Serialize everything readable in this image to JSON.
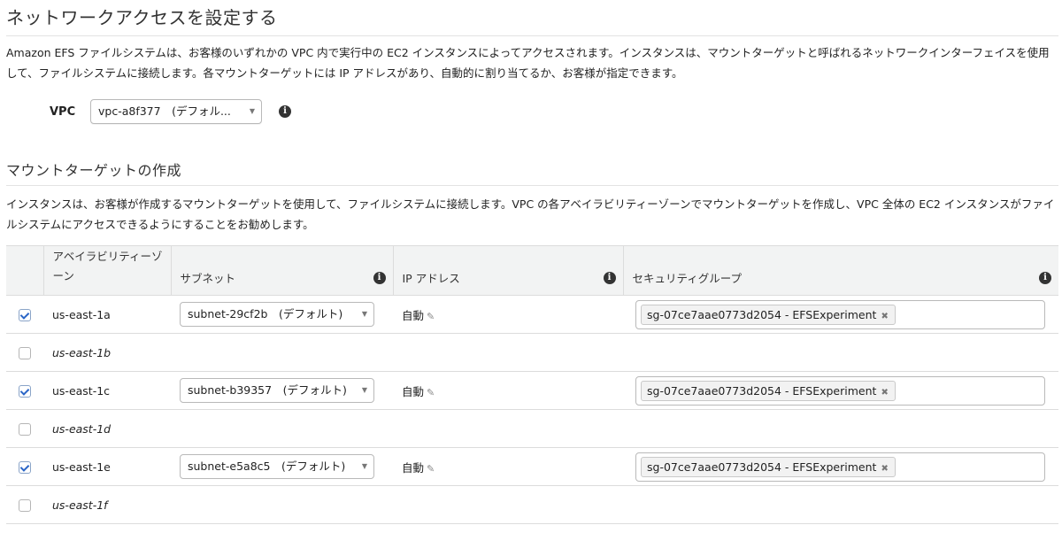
{
  "page": {
    "title": "ネットワークアクセスを設定する",
    "description": "Amazon EFS ファイルシステムは、お客様のいずれかの VPC 内で実行中の EC2 インスタンスによってアクセスされます。インスタンスは、マウントターゲットと呼ばれるネットワークインターフェイスを使用して、ファイルシステムに接続します。各マウントターゲットには IP アドレスがあり、自動的に割り当てるか、お客様が指定できます。"
  },
  "vpc": {
    "label": "VPC",
    "selected": "vpc-a8f377　(デフォル...",
    "info_icon": "info-icon"
  },
  "mount": {
    "title": "マウントターゲットの作成",
    "description": "インスタンスは、お客様が作成するマウントターゲットを使用して、ファイルシステムに接続します。VPC の各アベイラビリティーゾーンでマウントターゲットを作成し、VPC 全体の EC2 インスタンスがファイルシステムにアクセスできるようにすることをお勧めします。"
  },
  "table": {
    "headers": {
      "az": "アベイラビリティーゾーン",
      "subnet": "サブネット",
      "ip": "IP アドレス",
      "sg": "セキュリティグループ"
    },
    "rows": [
      {
        "checked": true,
        "az": "us-east-1a",
        "subnet": "subnet-29cf2b　(デフォルト)",
        "ip": "自動",
        "sg": "sg-07ce7aae0773d2054 - EFSExperiment"
      },
      {
        "checked": false,
        "az": "us-east-1b"
      },
      {
        "checked": true,
        "az": "us-east-1c",
        "subnet": "subnet-b39357　(デフォルト)",
        "ip": "自動",
        "sg": "sg-07ce7aae0773d2054 - EFSExperiment"
      },
      {
        "checked": false,
        "az": "us-east-1d"
      },
      {
        "checked": true,
        "az": "us-east-1e",
        "subnet": "subnet-e5a8c5　(デフォルト)",
        "ip": "自動",
        "sg": "sg-07ce7aae0773d2054 - EFSExperiment"
      },
      {
        "checked": false,
        "az": "us-east-1f"
      }
    ]
  },
  "icons": {
    "caret": "▼",
    "info": "i",
    "pencil": "✎",
    "remove": "✖"
  },
  "colors": {
    "header_bg": "#f2f3f3",
    "border": "#dcdcdc",
    "check": "#2b66c7",
    "disabled_text": "#b0b0b0"
  }
}
